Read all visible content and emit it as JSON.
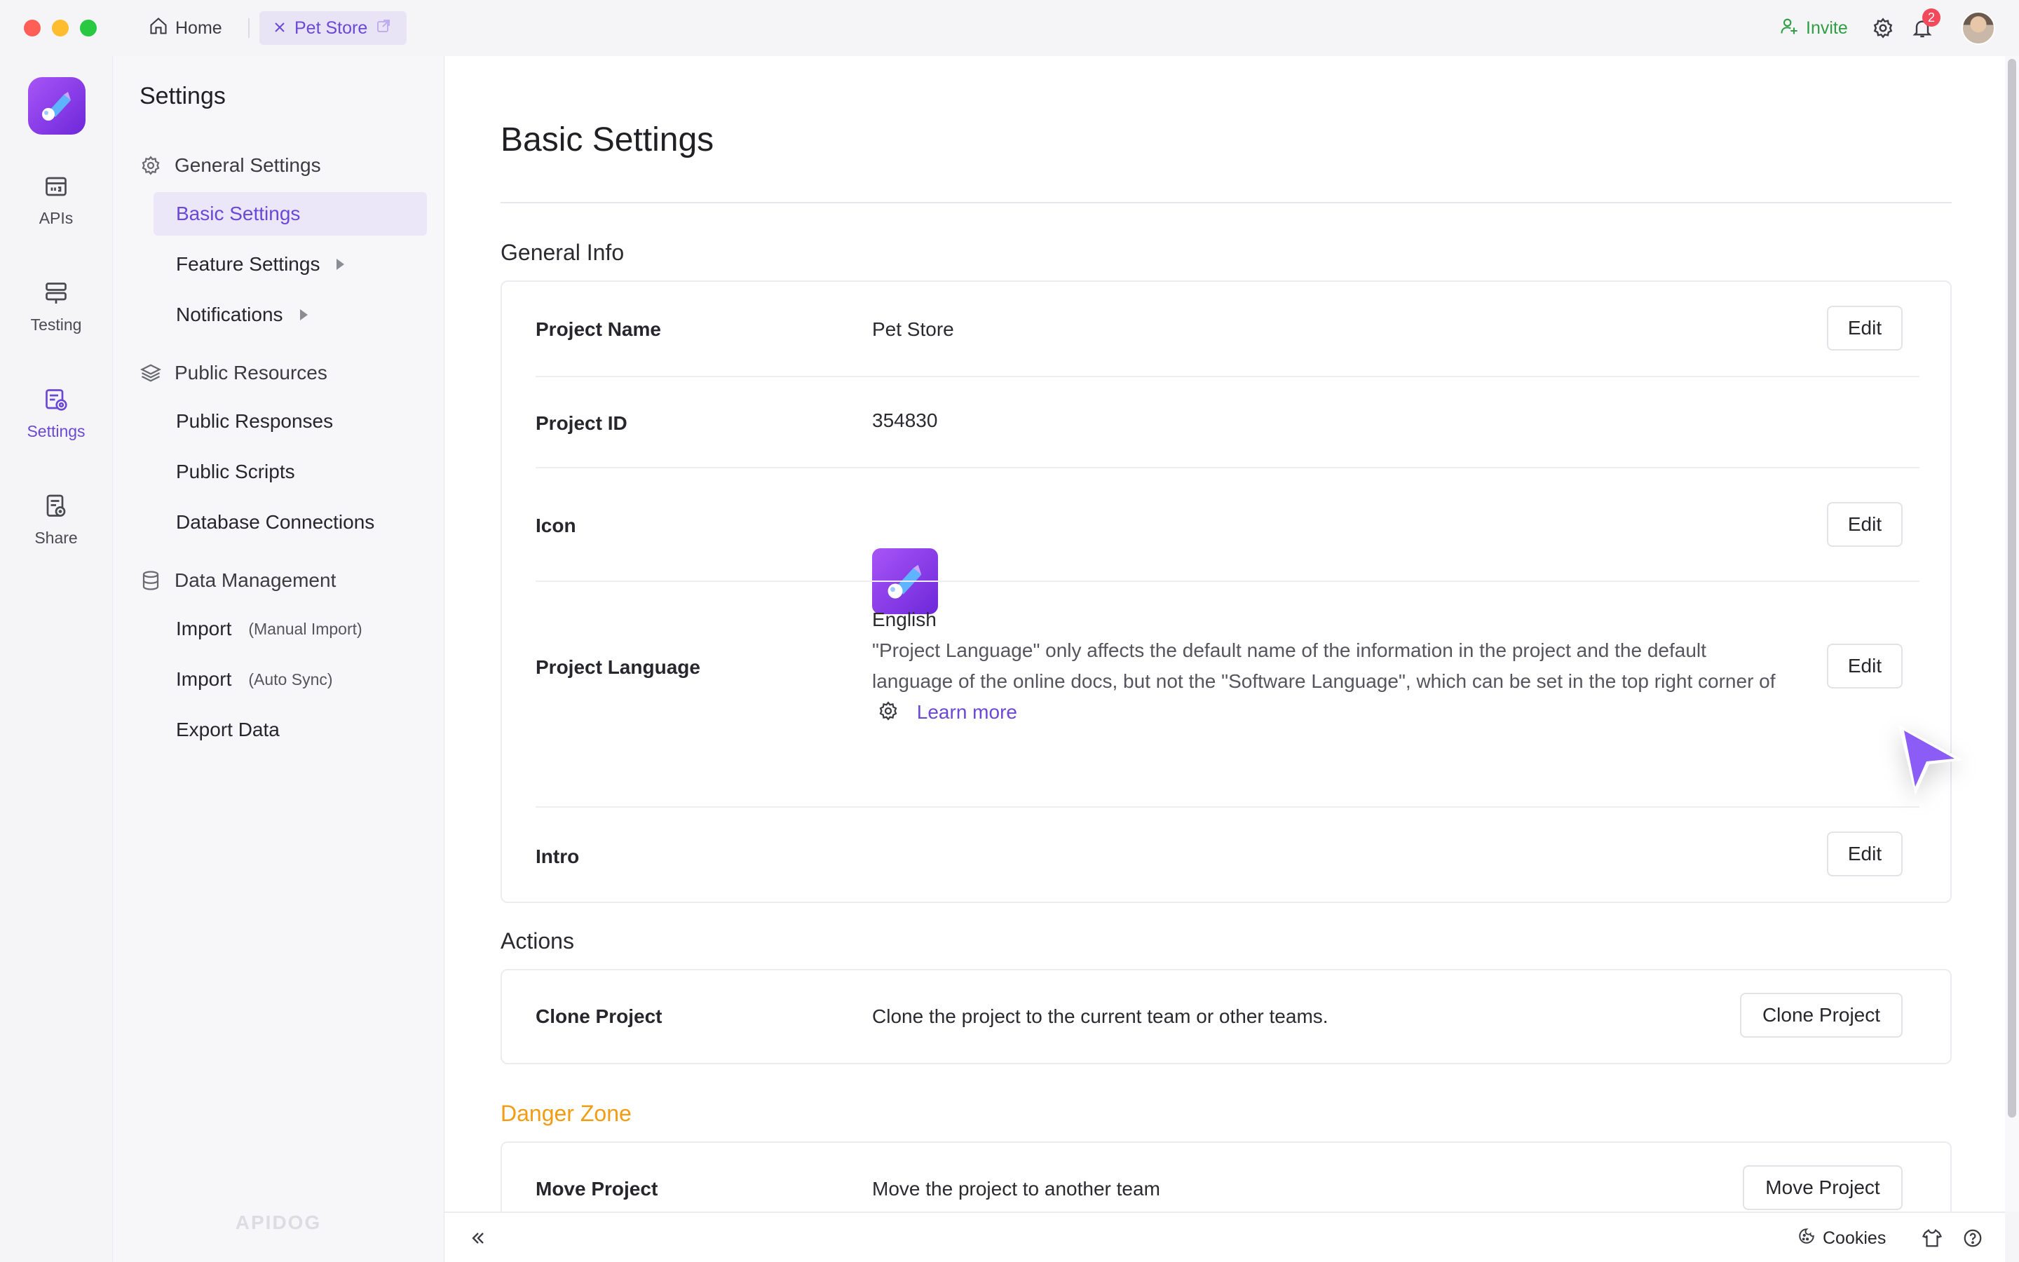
{
  "titlebar": {
    "tabs": [
      {
        "label": "Home",
        "icon": "home-icon"
      },
      {
        "label": "Pet Store",
        "icon": "close-icon",
        "active": true
      }
    ],
    "invite_label": "Invite",
    "notification_count": "2"
  },
  "rail": {
    "items": [
      {
        "label": "APIs",
        "icon": "apis-icon"
      },
      {
        "label": "Testing",
        "icon": "testing-icon"
      },
      {
        "label": "Settings",
        "icon": "settings-icon",
        "active": true
      },
      {
        "label": "Share",
        "icon": "share-icon"
      }
    ]
  },
  "nav": {
    "title": "Settings",
    "groups": [
      {
        "label": "General Settings",
        "icon": "gear-icon",
        "items": [
          {
            "label": "Basic Settings",
            "active": true
          },
          {
            "label": "Feature Settings",
            "has_submenu": true
          },
          {
            "label": "Notifications",
            "has_submenu": true
          }
        ]
      },
      {
        "label": "Public Resources",
        "icon": "layers-icon",
        "items": [
          {
            "label": "Public Responses"
          },
          {
            "label": "Public Scripts"
          },
          {
            "label": "Database Connections"
          }
        ]
      },
      {
        "label": "Data Management",
        "icon": "database-icon",
        "items": [
          {
            "label": "Import",
            "sub": "(Manual Import)"
          },
          {
            "label": "Import",
            "sub": "(Auto Sync)"
          },
          {
            "label": "Export Data"
          }
        ]
      }
    ],
    "brand": "APIDOG"
  },
  "main": {
    "page_title": "Basic Settings",
    "general_info": {
      "title": "General Info",
      "project_name": {
        "label": "Project Name",
        "value": "Pet Store",
        "button": "Edit"
      },
      "project_id": {
        "label": "Project ID",
        "value": "354830"
      },
      "icon": {
        "label": "Icon",
        "button": "Edit"
      },
      "project_language": {
        "label": "Project Language",
        "value": "English",
        "description": "\"Project Language\" only affects the default name of the information in the project and the default language of the online docs, but not the \"Software Language\", which can be set in the top right corner of",
        "learn_more": "Learn more",
        "button": "Edit"
      },
      "intro": {
        "label": "Intro",
        "button": "Edit"
      }
    },
    "actions": {
      "title": "Actions",
      "clone_project": {
        "label": "Clone Project",
        "description": "Clone the project to the current team or other teams.",
        "button": "Clone Project"
      }
    },
    "danger_zone": {
      "title": "Danger Zone",
      "move_project": {
        "label": "Move Project",
        "description": "Move the project to another team",
        "button": "Move Project"
      }
    }
  },
  "bottombar": {
    "cookies_label": "Cookies"
  },
  "colors": {
    "accent": "#6b48d6",
    "invite": "#2f9e44",
    "danger_title": "#f39c12",
    "badge": "#f24a5a"
  }
}
